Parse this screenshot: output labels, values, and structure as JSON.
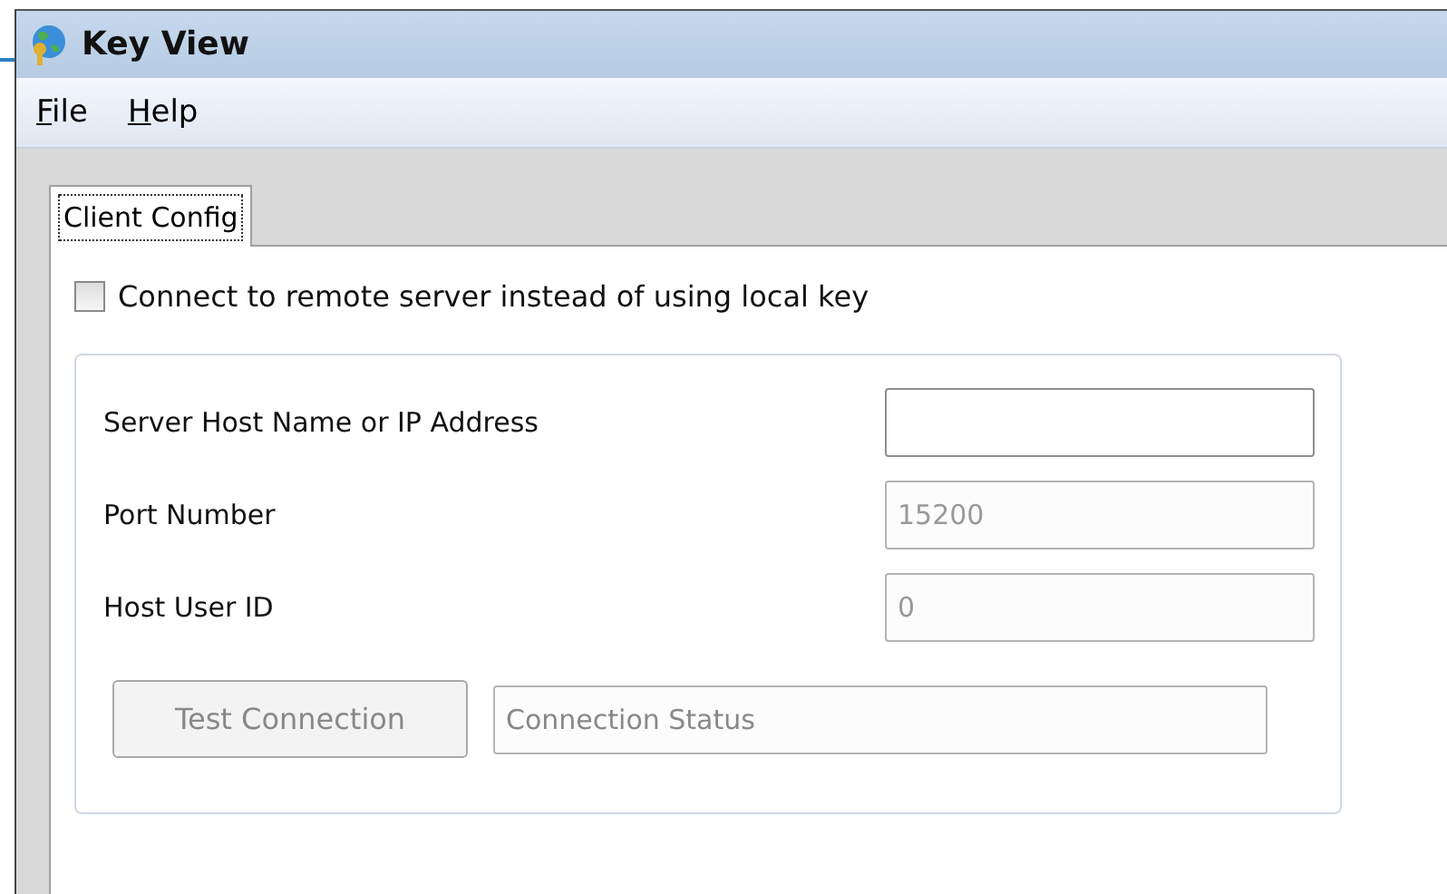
{
  "window": {
    "title": "Key View"
  },
  "menu": [
    {
      "label": "File"
    },
    {
      "label": "Help"
    }
  ],
  "tabs": [
    {
      "label": "Client Config",
      "selected": true
    }
  ],
  "remote_checkbox": {
    "label": "Connect to remote server instead of using local key",
    "checked": false
  },
  "fields": [
    {
      "label": "Server Host Name or IP Address",
      "disabled": false
    },
    {
      "label": "Port Number",
      "value": "15200",
      "disabled": true
    },
    {
      "label": "Host User ID",
      "value": "0",
      "disabled": true
    }
  ],
  "test_button": {
    "label": "Test Connection",
    "disabled": true
  },
  "status_field": {
    "placeholder": "Connection Status",
    "disabled": true
  }
}
